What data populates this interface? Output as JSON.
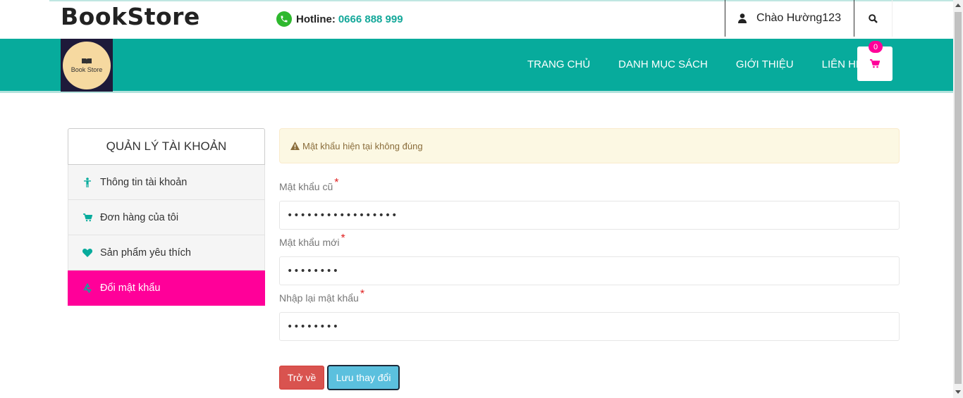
{
  "header": {
    "brand": "BookStore",
    "hotline_label": "Hotline:",
    "hotline_number": "0666 888 999",
    "greeting": "Chào Hường123"
  },
  "nav": {
    "logo_text": "Book Store",
    "links": [
      "TRANG CHỦ",
      "DANH MỤC SÁCH",
      "GIỚI THIỆU",
      "LIÊN HỆ"
    ],
    "cart_count": "0"
  },
  "sidebar": {
    "title": "QUẢN LÝ TÀI KHOẢN",
    "items": [
      {
        "label": "Thông tin tài khoản",
        "icon": "user-icon"
      },
      {
        "label": "Đơn hàng của tôi",
        "icon": "cart-icon"
      },
      {
        "label": "Sản phẩm yêu thích",
        "icon": "heart-icon"
      },
      {
        "label": "Đổi mật khẩu",
        "icon": "recycle-icon",
        "active": true
      }
    ]
  },
  "alert": {
    "message": "Mật khẩu hiện tại không đúng"
  },
  "form": {
    "old_password_label": "Mật khẩu cũ",
    "old_password_value": "•••••••••••••••••",
    "new_password_label": "Mật khẩu mới",
    "new_password_value": "••••••••",
    "confirm_password_label": "Nhập lại mật khẩu",
    "confirm_password_value": "••••••••",
    "required_mark": "*",
    "back_label": "Trở về",
    "save_label": "Lưu thay đổi"
  },
  "colors": {
    "brand_teal": "#07ab9c",
    "accent_pink": "#ff0099",
    "danger": "#d9534f",
    "info": "#5bc0de"
  }
}
